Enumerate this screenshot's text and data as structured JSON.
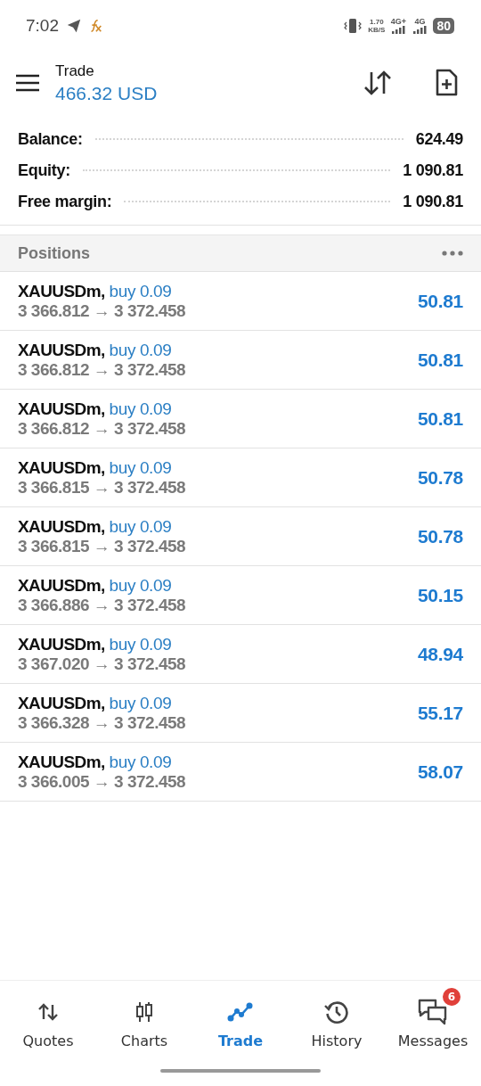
{
  "status_bar": {
    "time": "7:02",
    "data_rate": [
      "1.70",
      "KB/S"
    ],
    "networks": [
      "4G+",
      "4G"
    ],
    "battery": "80"
  },
  "header": {
    "title": "Trade",
    "subtitle": "466.32 USD"
  },
  "summary": [
    {
      "label": "Balance:",
      "value": "624.49"
    },
    {
      "label": "Equity:",
      "value": "1 090.81"
    },
    {
      "label": "Free margin:",
      "value": "1 090.81"
    }
  ],
  "positions": {
    "title": "Positions",
    "rows": [
      {
        "symbol": "XAUUSDm,",
        "order": "buy 0.09",
        "prices": "3 366.812 → 3 372.458",
        "profit": "50.81"
      },
      {
        "symbol": "XAUUSDm,",
        "order": "buy 0.09",
        "prices": "3 366.812 → 3 372.458",
        "profit": "50.81"
      },
      {
        "symbol": "XAUUSDm,",
        "order": "buy 0.09",
        "prices": "3 366.812 → 3 372.458",
        "profit": "50.81"
      },
      {
        "symbol": "XAUUSDm,",
        "order": "buy 0.09",
        "prices": "3 366.815 → 3 372.458",
        "profit": "50.78"
      },
      {
        "symbol": "XAUUSDm,",
        "order": "buy 0.09",
        "prices": "3 366.815 → 3 372.458",
        "profit": "50.78"
      },
      {
        "symbol": "XAUUSDm,",
        "order": "buy 0.09",
        "prices": "3 366.886 → 3 372.458",
        "profit": "50.15"
      },
      {
        "symbol": "XAUUSDm,",
        "order": "buy 0.09",
        "prices": "3 367.020 → 3 372.458",
        "profit": "48.94"
      },
      {
        "symbol": "XAUUSDm,",
        "order": "buy 0.09",
        "prices": "3 366.328 → 3 372.458",
        "profit": "55.17"
      },
      {
        "symbol": "XAUUSDm,",
        "order": "buy 0.09",
        "prices": "3 366.005 → 3 372.458",
        "profit": "58.07"
      }
    ]
  },
  "bottom_nav": [
    {
      "kind": "quotes",
      "label": "Quotes",
      "selected": false
    },
    {
      "kind": "charts",
      "label": "Charts",
      "selected": false
    },
    {
      "kind": "trade",
      "label": "Trade",
      "selected": true
    },
    {
      "kind": "history",
      "label": "History",
      "selected": false
    },
    {
      "kind": "messages",
      "label": "Messages",
      "selected": false,
      "badge": "6"
    }
  ]
}
